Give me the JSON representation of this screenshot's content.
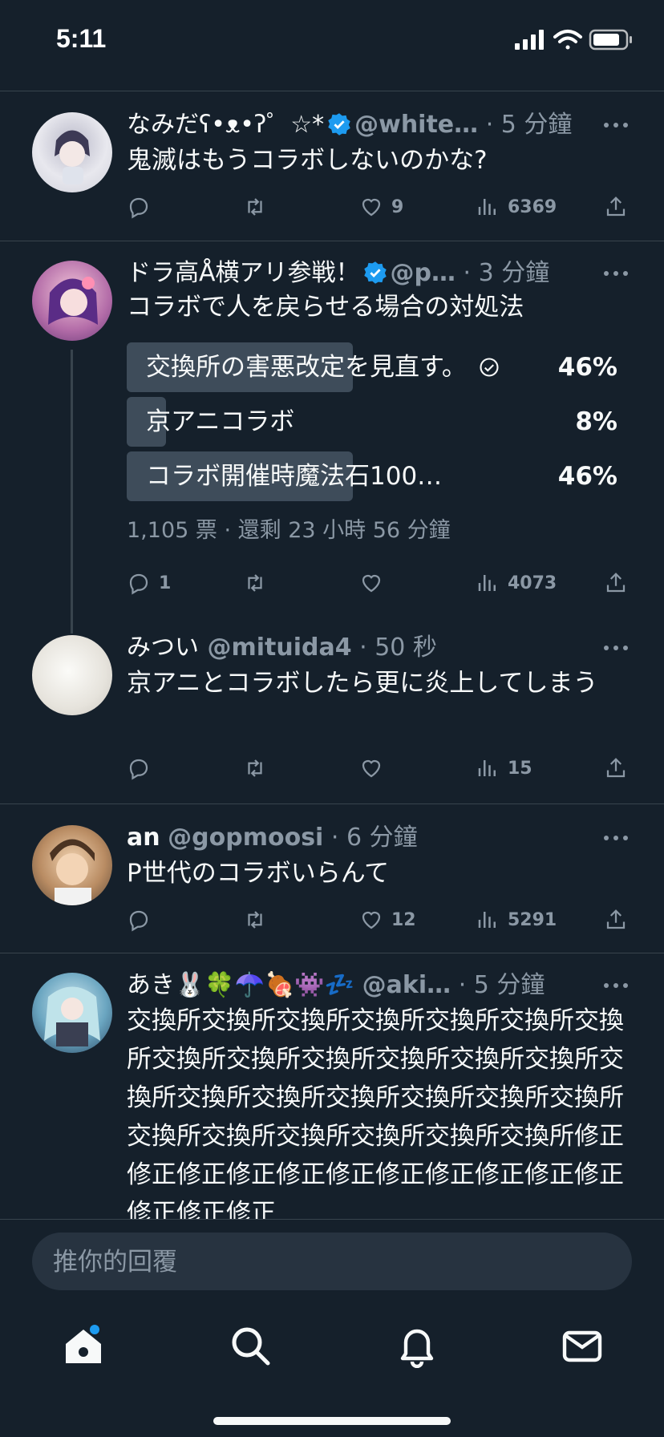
{
  "status_bar": {
    "time": "5:11"
  },
  "tweets": [
    {
      "name": "なみだʕ•ᴥ•ʔ゜☆*",
      "handle": "@white…",
      "time": "5 分鐘",
      "text": "鬼滅はもうコラボしないのかな?",
      "likes": "9",
      "views": "6369"
    },
    {
      "name": "ドラ高Å横アリ参戦！",
      "handle": "@p…",
      "time": "3 分鐘",
      "text": "コラボで人を戻らせる場合の対処法",
      "poll": {
        "options": [
          {
            "label": "交換所の害悪改定を見直す。",
            "percent": "46%",
            "fraction": 0.46,
            "selected": true
          },
          {
            "label": "京アニコラボ",
            "percent": "8%",
            "fraction": 0.08,
            "selected": false
          },
          {
            "label": "コラボ開催時魔法石100…",
            "percent": "46%",
            "fraction": 0.46,
            "selected": false
          }
        ],
        "meta": "1,105 票 · 還剩 23 小時 56 分鐘"
      },
      "replies": "1",
      "views": "4073"
    },
    {
      "name": "みつい",
      "handle": "@mituida4",
      "time": "50 秒",
      "text": "京アニとコラボしたら更に炎上してしまう",
      "views": "15"
    },
    {
      "name": "an",
      "handle": "@gopmoosi",
      "time": "6 分鐘",
      "text": "P世代のコラボいらんて",
      "likes": "12",
      "views": "5291"
    },
    {
      "name": "あき🐰🍀☂️🍖👾💤",
      "handle": "@aki…",
      "time": "5 分鐘",
      "text": "交換所交換所交換所交換所交換所交換所交換所交換所交換所交換所交換所交換所交換所交換所交換所交換所交換所交換所交換所交換所交換所交換所交換所交換所交換所交換所修正修正修正修正修正修正修正修正修正修正修正修正修正修正"
    }
  ],
  "reply": {
    "placeholder": "推你的回覆"
  },
  "colors": {
    "background": "#15202b",
    "accent": "#1d9bf0",
    "muted": "#8b98a5",
    "divider": "#38444d"
  },
  "icons": [
    "home-icon",
    "search-icon",
    "bell-icon",
    "mail-icon",
    "reply-icon",
    "retweet-icon",
    "like-icon",
    "views-icon",
    "share-icon",
    "more-icon",
    "verified-icon"
  ]
}
